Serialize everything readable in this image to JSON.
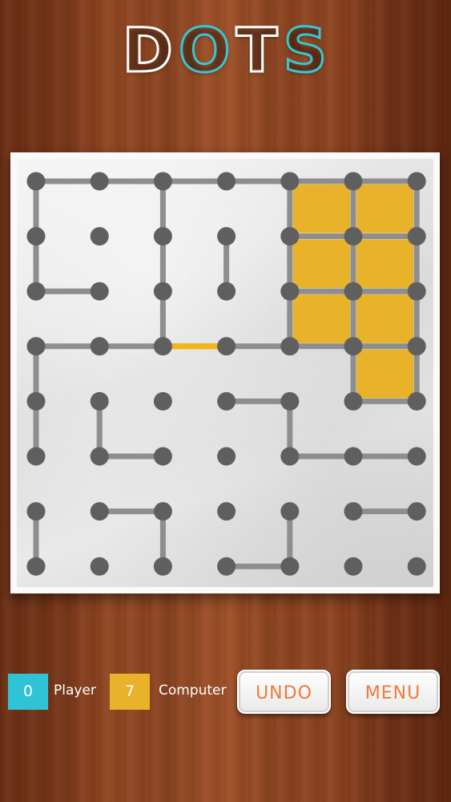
{
  "title": {
    "letters": [
      "D",
      "O",
      "T",
      "S"
    ]
  },
  "colors": {
    "player": "#2fc3d5",
    "computer": "#e8b22a",
    "line": "#8e8e8e",
    "dot": "#5f5f5f",
    "last_move": "#f4b616",
    "button_text": "#f07a3a"
  },
  "grid": {
    "rows": 8,
    "cols": 7,
    "horizontal_lines": [
      [
        0,
        0
      ],
      [
        0,
        1
      ],
      [
        0,
        2
      ],
      [
        0,
        3
      ],
      [
        0,
        4
      ],
      [
        0,
        5
      ],
      [
        1,
        4
      ],
      [
        1,
        5
      ],
      [
        2,
        0
      ],
      [
        2,
        4
      ],
      [
        2,
        5
      ],
      [
        3,
        0
      ],
      [
        3,
        1
      ],
      [
        3,
        2
      ],
      [
        3,
        3
      ],
      [
        3,
        4
      ],
      [
        3,
        5
      ],
      [
        4,
        3
      ],
      [
        4,
        5
      ],
      [
        5,
        1
      ],
      [
        5,
        4
      ],
      [
        5,
        5
      ],
      [
        6,
        1
      ],
      [
        6,
        5
      ],
      [
        7,
        3
      ]
    ],
    "vertical_lines": [
      [
        0,
        0
      ],
      [
        0,
        2
      ],
      [
        0,
        4
      ],
      [
        0,
        5
      ],
      [
        0,
        6
      ],
      [
        1,
        0
      ],
      [
        1,
        2
      ],
      [
        1,
        3
      ],
      [
        1,
        4
      ],
      [
        1,
        5
      ],
      [
        1,
        6
      ],
      [
        2,
        2
      ],
      [
        2,
        4
      ],
      [
        2,
        5
      ],
      [
        2,
        6
      ],
      [
        3,
        0
      ],
      [
        3,
        5
      ],
      [
        3,
        6
      ],
      [
        4,
        0
      ],
      [
        4,
        1
      ],
      [
        4,
        4
      ],
      [
        6,
        0
      ],
      [
        6,
        2
      ],
      [
        6,
        4
      ]
    ],
    "last_move": {
      "type": "h",
      "row": 3,
      "col": 2
    },
    "claimed_boxes": [
      {
        "row": 0,
        "col": 4,
        "owner": "computer"
      },
      {
        "row": 0,
        "col": 5,
        "owner": "computer"
      },
      {
        "row": 1,
        "col": 4,
        "owner": "computer"
      },
      {
        "row": 1,
        "col": 5,
        "owner": "computer"
      },
      {
        "row": 2,
        "col": 4,
        "owner": "computer"
      },
      {
        "row": 2,
        "col": 5,
        "owner": "computer"
      },
      {
        "row": 3,
        "col": 5,
        "owner": "computer"
      }
    ]
  },
  "scores": {
    "player": {
      "value": "0",
      "label": "Player"
    },
    "computer": {
      "value": "7",
      "label": "Computer"
    }
  },
  "buttons": {
    "undo": "UNDO",
    "menu": "MENU"
  }
}
